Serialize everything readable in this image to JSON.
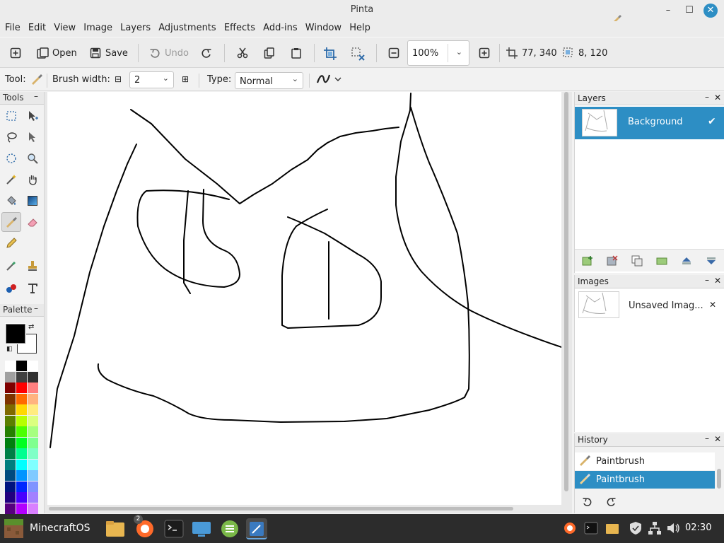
{
  "window": {
    "title": "Pinta"
  },
  "menu": [
    "File",
    "Edit",
    "View",
    "Image",
    "Layers",
    "Adjustments",
    "Effects",
    "Add-ins",
    "Window",
    "Help"
  ],
  "toolbar": {
    "open_label": "Open",
    "save_label": "Save",
    "undo_label": "Undo",
    "zoom_value": "100%",
    "cursor_pos": "77, 340",
    "selection_size": "8, 120"
  },
  "tool_options": {
    "tool_label": "Tool:",
    "brush_width_label": "Brush width:",
    "brush_width_value": "2",
    "type_label": "Type:",
    "type_value": "Normal"
  },
  "panels": {
    "tools_title": "Tools",
    "palette_title": "Palette",
    "layers_title": "Layers",
    "images_title": "Images",
    "history_title": "History"
  },
  "layers": [
    {
      "name": "Background",
      "visible": true
    }
  ],
  "images": [
    {
      "name": "Unsaved Imag..."
    }
  ],
  "history": [
    {
      "label": "Paintbrush",
      "selected": false
    },
    {
      "label": "Paintbrush",
      "selected": true
    }
  ],
  "palette": {
    "primary": "#000000",
    "secondary": "#ffffff",
    "colors": [
      [
        "#ffffff",
        "#000000",
        "#ffffff"
      ],
      [
        "#a0a0a0",
        "#404040",
        "#303030"
      ],
      [
        "#7f0000",
        "#ff0000",
        "#ff8080"
      ],
      [
        "#7f3300",
        "#ff6a00",
        "#ffb380"
      ],
      [
        "#7f6a00",
        "#ffd800",
        "#ffec80"
      ],
      [
        "#5b7f00",
        "#b6ff00",
        "#dbff80"
      ],
      [
        "#267f00",
        "#4cff00",
        "#a6ff80"
      ],
      [
        "#007f0e",
        "#00ff21",
        "#80ff90"
      ],
      [
        "#007f46",
        "#00ff90",
        "#80ffc7"
      ],
      [
        "#007f7f",
        "#00ffff",
        "#80ffff"
      ],
      [
        "#004a7f",
        "#0094ff",
        "#80caff"
      ],
      [
        "#00137f",
        "#0026ff",
        "#8093ff"
      ],
      [
        "#21007f",
        "#4800ff",
        "#a380ff"
      ],
      [
        "#57007f",
        "#b200ff",
        "#d980ff"
      ]
    ]
  },
  "taskbar": {
    "start_label": "MinecraftOS",
    "badge_count": "2",
    "clock": "02:30"
  },
  "accent": "#2d8ec4"
}
